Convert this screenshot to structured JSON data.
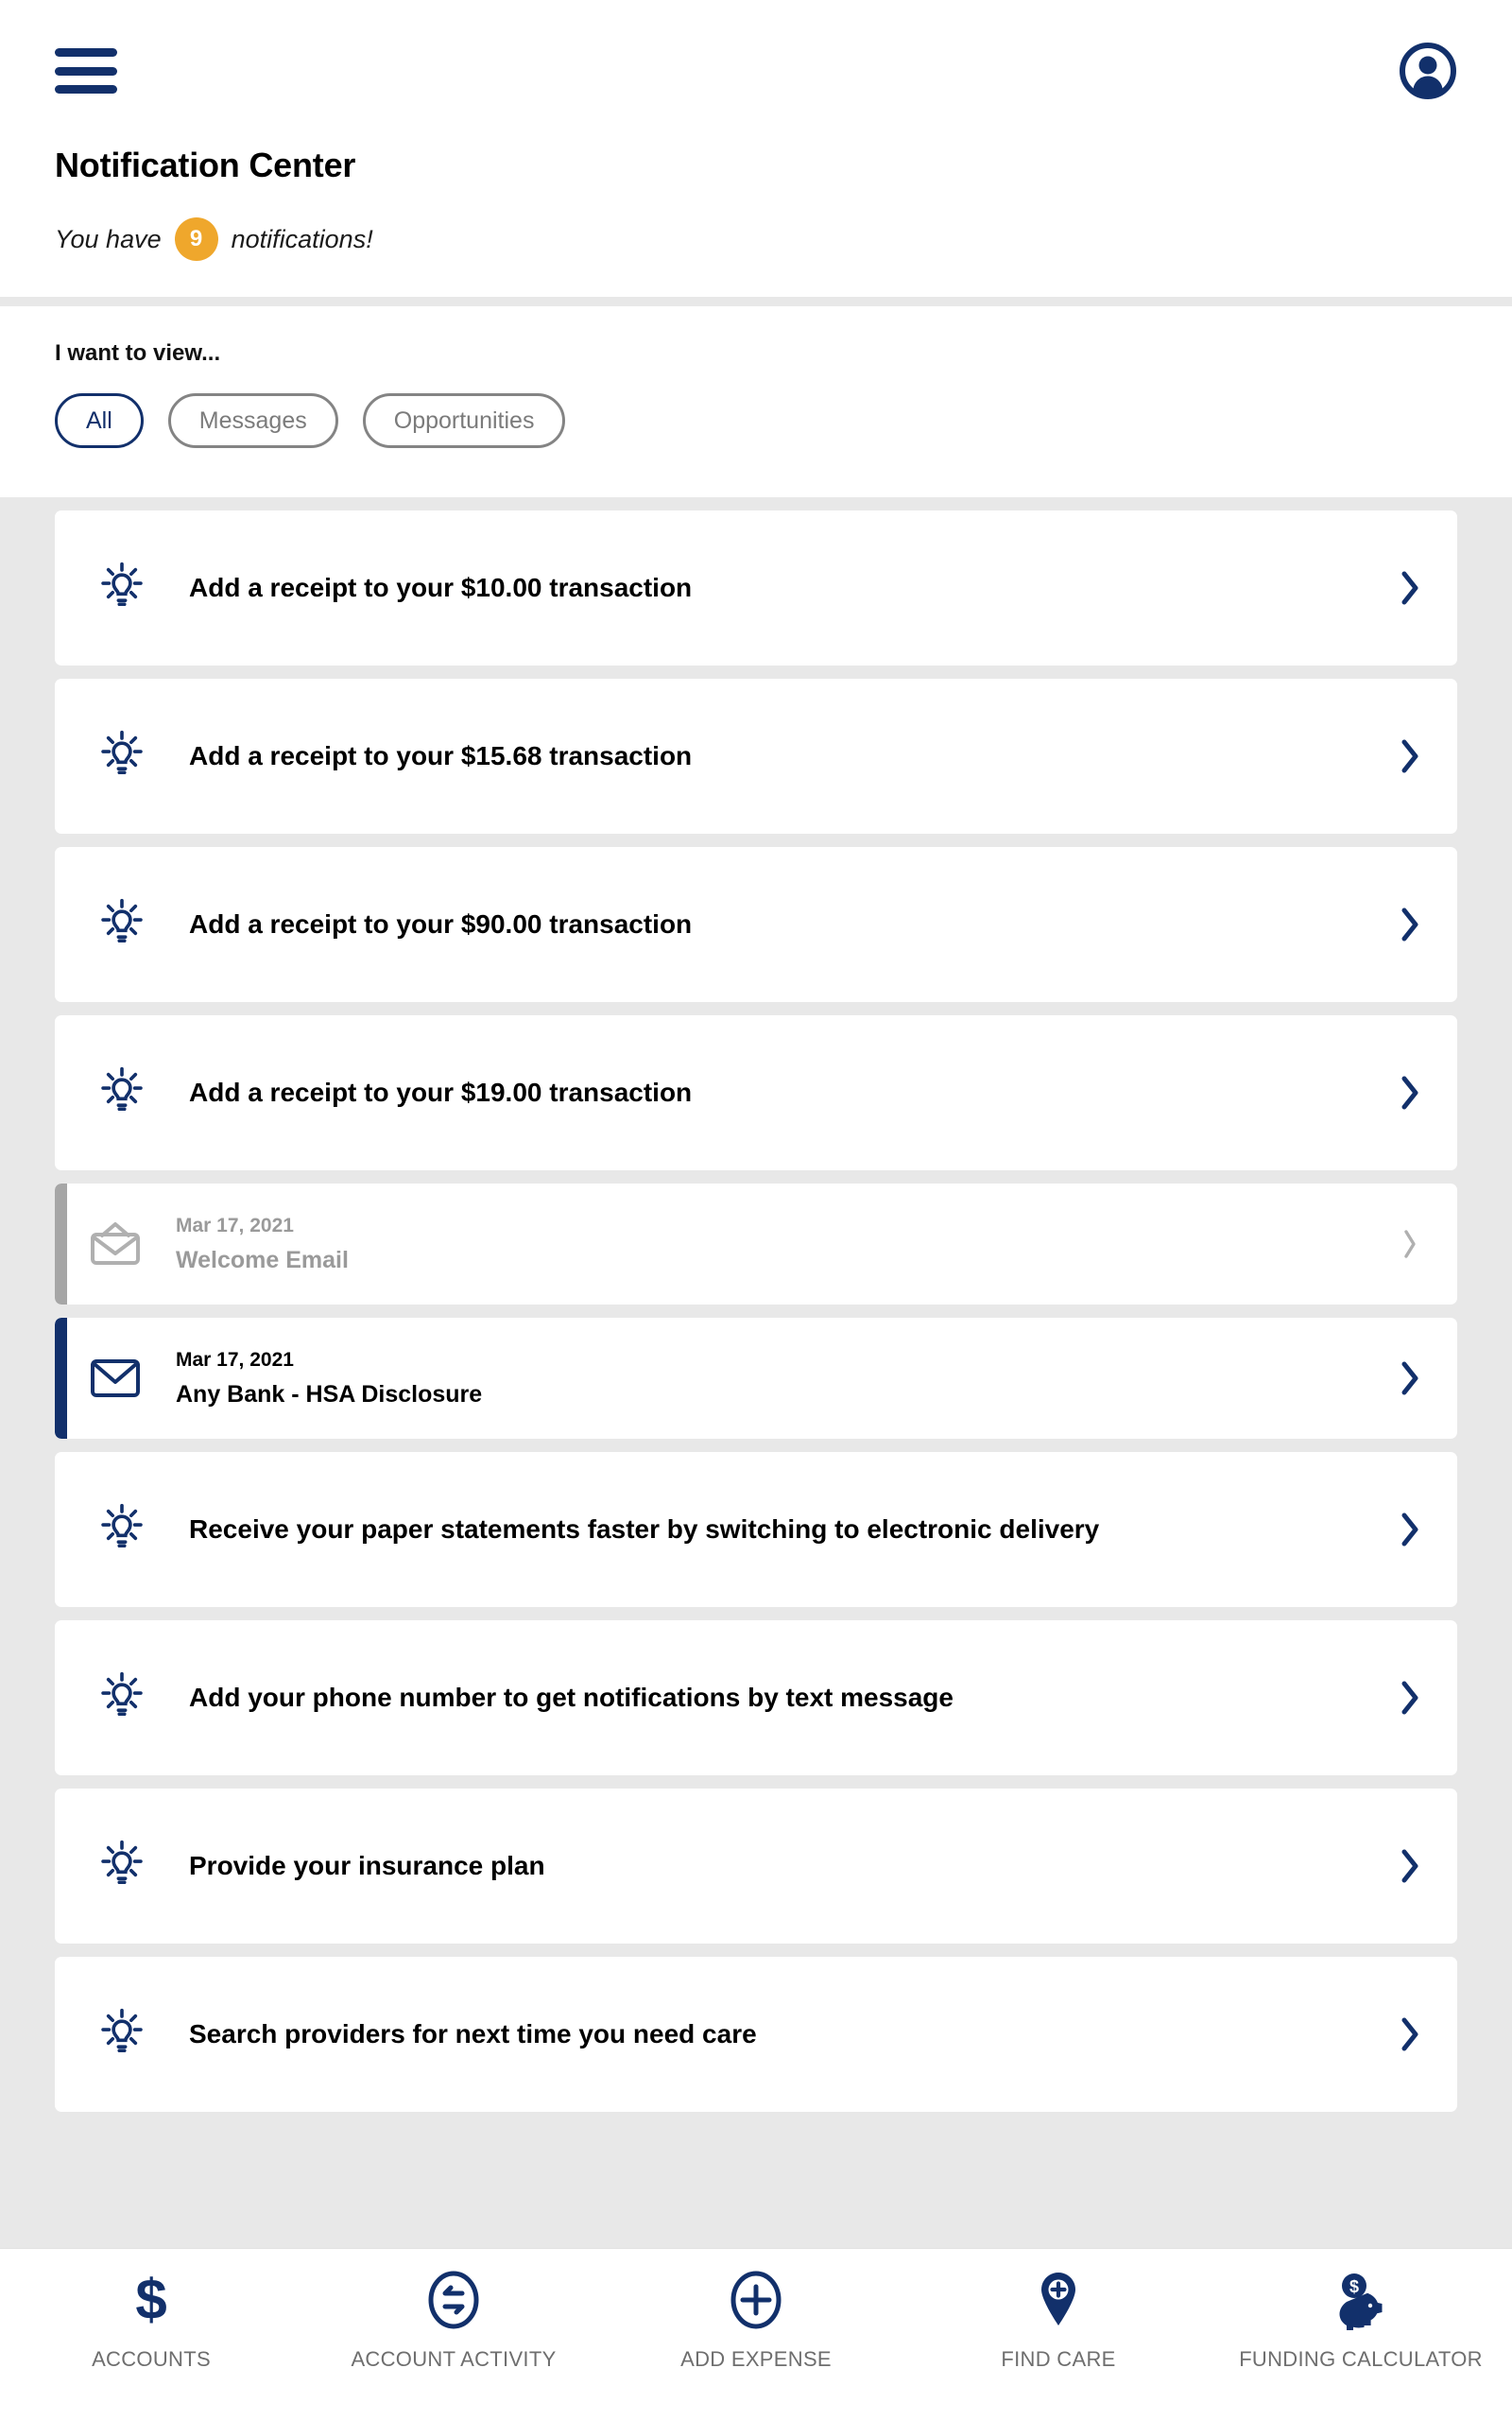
{
  "header": {
    "menu_icon": "hamburger-menu-icon",
    "avatar_icon": "user-account-icon",
    "title": "Notification Center",
    "subtitle_prefix": "You have",
    "notification_count": "9",
    "subtitle_suffix": "notifications!",
    "badge_color": "#efa72c"
  },
  "filter": {
    "label": "I want to view...",
    "options": [
      {
        "label": "All",
        "selected": true
      },
      {
        "label": "Messages",
        "selected": false
      },
      {
        "label": "Opportunities",
        "selected": false
      }
    ]
  },
  "notifications": [
    {
      "type": "opportunity",
      "icon": "lightbulb-icon",
      "title": "Add a receipt to your $10.00 transaction",
      "chevron": "chevron-right-icon"
    },
    {
      "type": "opportunity",
      "icon": "lightbulb-icon",
      "title": "Add a receipt to your $15.68 transaction",
      "chevron": "chevron-right-icon"
    },
    {
      "type": "opportunity",
      "icon": "lightbulb-icon",
      "title": "Add a receipt to your $90.00 transaction",
      "chevron": "chevron-right-icon"
    },
    {
      "type": "opportunity",
      "icon": "lightbulb-icon",
      "title": "Add a receipt to your $19.00 transaction",
      "chevron": "chevron-right-icon"
    },
    {
      "type": "message",
      "state": "read",
      "icon": "envelope-open-icon",
      "date": "Mar 17, 2021",
      "subject": "Welcome Email",
      "chevron": "chevron-right-icon"
    },
    {
      "type": "message",
      "state": "unread",
      "icon": "envelope-closed-icon",
      "date": "Mar 17, 2021",
      "subject": "Any Bank - HSA Disclosure",
      "chevron": "chevron-right-icon"
    },
    {
      "type": "opportunity",
      "icon": "lightbulb-icon",
      "title": "Receive your paper statements faster by switching to electronic delivery",
      "chevron": "chevron-right-icon"
    },
    {
      "type": "opportunity",
      "icon": "lightbulb-icon",
      "title": "Add your phone number to get notifications by text message",
      "chevron": "chevron-right-icon"
    },
    {
      "type": "opportunity",
      "icon": "lightbulb-icon",
      "title": "Provide your insurance plan",
      "chevron": "chevron-right-icon"
    },
    {
      "type": "opportunity",
      "icon": "lightbulb-icon",
      "title": "Search providers for next time you need care",
      "chevron": "chevron-right-icon"
    }
  ],
  "footer_nav": [
    {
      "icon": "dollar-sign-icon",
      "label": "ACCOUNTS"
    },
    {
      "icon": "transfer-arrows-circle-icon",
      "label": "ACCOUNT ACTIVITY"
    },
    {
      "icon": "plus-circle-icon",
      "label": "ADD EXPENSE"
    },
    {
      "icon": "map-pin-plus-icon",
      "label": "FIND CARE"
    },
    {
      "icon": "piggy-bank-icon",
      "label": "FUNDING CALCULATOR"
    }
  ],
  "colors": {
    "brand_navy": "#12306b",
    "accent_orange": "#efa72c",
    "page_background": "#e8e8e8",
    "muted_grey": "#9a9a9a"
  }
}
